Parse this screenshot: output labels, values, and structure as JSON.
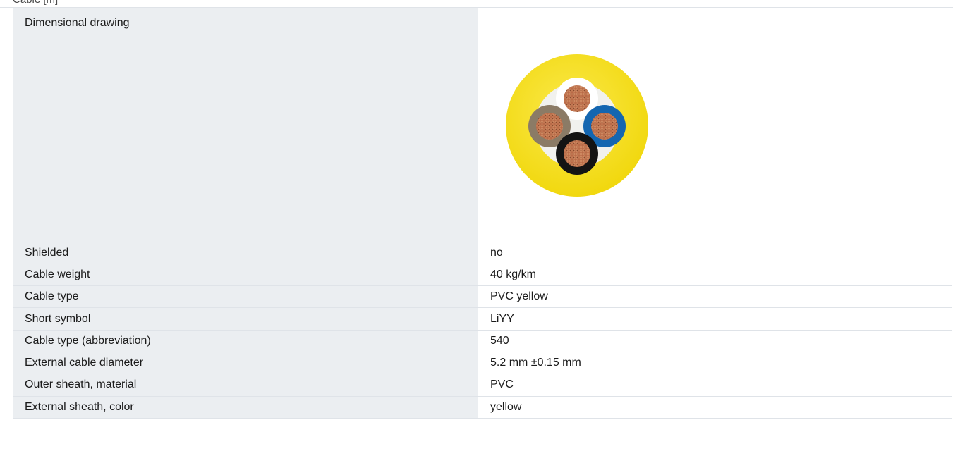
{
  "header": {
    "cropped_text": "Cable  [m]"
  },
  "drawing": {
    "label": "Dimensional drawing",
    "image_alt": "cable cross-section",
    "colors": {
      "sheath": "#f7e11a",
      "filler": "#f3f3f1",
      "core_white": "#ffffff",
      "core_brown": "#8a7a66",
      "core_blue": "#1466b0",
      "core_black": "#141414",
      "copper": "#b96b48"
    }
  },
  "rows": [
    {
      "label": "Shielded",
      "value": "no"
    },
    {
      "label": "Cable weight",
      "value": "40 kg/km"
    },
    {
      "label": "Cable type",
      "value": "PVC yellow"
    },
    {
      "label": "Short symbol",
      "value": "LiYY"
    },
    {
      "label": "Cable type (abbreviation)",
      "value": "540"
    },
    {
      "label": "External cable diameter",
      "value": "5.2 mm ±0.15 mm"
    },
    {
      "label": "Outer sheath, material",
      "value": "PVC"
    },
    {
      "label": "External sheath, color",
      "value": "yellow"
    }
  ]
}
